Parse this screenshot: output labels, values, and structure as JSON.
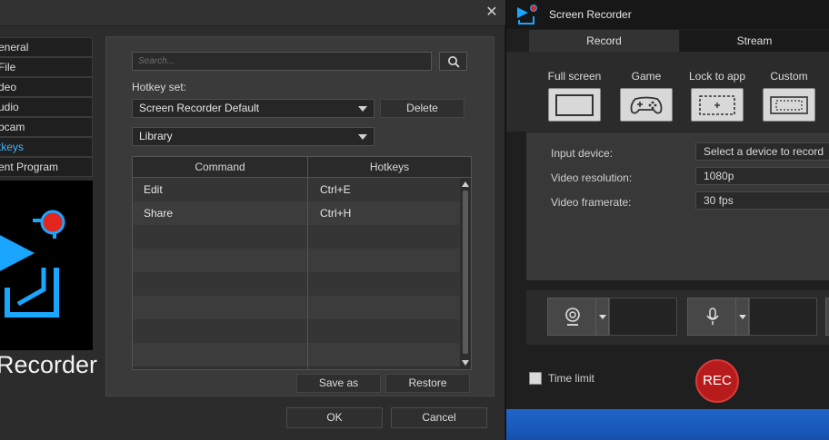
{
  "dialog": {
    "close_glyph": "✕",
    "nav": [
      {
        "label": "General",
        "active": false
      },
      {
        "label": "File",
        "active": false
      },
      {
        "label": "Video",
        "active": false
      },
      {
        "label": "Audio",
        "active": false
      },
      {
        "label": "Webcam",
        "active": false
      },
      {
        "label": "Hotkeys",
        "active": true
      },
      {
        "label": "Event Program",
        "active": false
      }
    ],
    "nav_display": [
      "eneral",
      "File",
      "deo",
      "udio",
      "bcam",
      "tkeys",
      "ent Program"
    ],
    "brand_text": "Recorder",
    "search": {
      "placeholder": "Search..."
    },
    "hotkey_set_label": "Hotkey set:",
    "hotkey_set_value": "Screen Recorder Default",
    "delete_label": "Delete",
    "category_value": "Library",
    "table": {
      "headers": [
        "Command",
        "Hotkeys"
      ],
      "rows": [
        {
          "command": "Edit",
          "hotkey": "Ctrl+E"
        },
        {
          "command": "Share",
          "hotkey": "Ctrl+H"
        }
      ]
    },
    "save_as_label": "Save as",
    "restore_label": "Restore",
    "ok_label": "OK",
    "cancel_label": "Cancel"
  },
  "recorder": {
    "title": "Screen Recorder",
    "tabs": [
      {
        "label": "Record",
        "active": true
      },
      {
        "label": "Stream",
        "active": false
      }
    ],
    "modes": [
      {
        "label": "Full screen",
        "icon": "fullscreen-icon"
      },
      {
        "label": "Game",
        "icon": "gamepad-icon"
      },
      {
        "label": "Lock to app",
        "icon": "lock-to-app-icon"
      },
      {
        "label": "Custom",
        "icon": "custom-region-icon"
      }
    ],
    "input_device_label": "Input device:",
    "input_device_value": "Select a device to record",
    "resolution_label": "Video resolution:",
    "resolution_value": "1080p",
    "framerate_label": "Video framerate:",
    "framerate_value": "30 fps",
    "time_limit_label": "Time limit",
    "rec_label": "REC"
  },
  "colors": {
    "accent_blue": "#3fb8ff",
    "rec_red": "#b81b1b"
  }
}
